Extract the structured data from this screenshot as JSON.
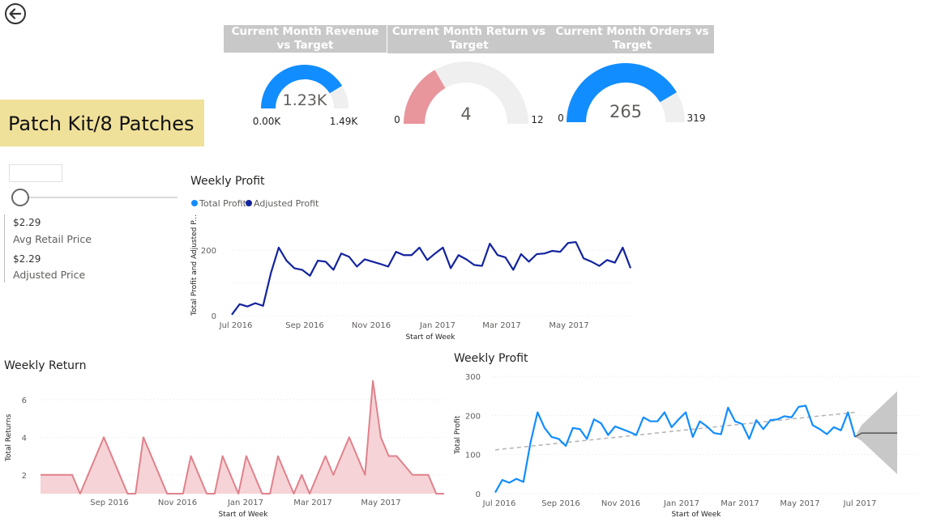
{
  "nav": {
    "back_icon": "back-arrow-icon"
  },
  "kpis": [
    {
      "title": "Current Month Revenue vs Target",
      "value": "1.23K",
      "min": "0.00K",
      "max": "1.49K",
      "fill_fraction": 0.826,
      "color": "#118dff"
    },
    {
      "title": "Current Month Return vs Target",
      "value": "4",
      "min": "0",
      "max": "12",
      "fill_fraction": 0.333,
      "color": "#e8959c"
    },
    {
      "title": "Current Month Orders vs Target",
      "value": "265",
      "min": "0",
      "max": "319",
      "fill_fraction": 0.831,
      "color": "#118dff"
    }
  ],
  "product": {
    "name": "Patch Kit/8 Patches"
  },
  "prices": {
    "avg_retail_value": "$2.29",
    "avg_retail_label": "Avg Retail Price",
    "adjusted_value": "$2.29",
    "adjusted_label": "Adjusted Price"
  },
  "colors": {
    "total_profit": "#118dff",
    "adjusted_profit": "#12239e",
    "returns_line": "#e0818c",
    "returns_fill": "#f6d3d6",
    "trend": "#b3b3b3",
    "forecast": "#c8c8c8"
  },
  "chart_data": [
    {
      "id": "weekly_profit_top",
      "type": "line",
      "title": "Weekly Profit",
      "xlabel": "Start of Week",
      "ylabel": "Total Profit and Adjusted P...",
      "legend": [
        "Total Profit",
        "Adjusted Profit"
      ],
      "legend_position": "top-left",
      "x_ticks": [
        "Jul 2016",
        "Sep 2016",
        "Nov 2016",
        "Jan 2017",
        "Mar 2017",
        "May 2017"
      ],
      "y_ticks": [
        "0",
        "200"
      ],
      "ylim": [
        0,
        240
      ],
      "series": [
        {
          "name": "Adjusted Profit",
          "values": [
            3,
            35,
            28,
            38,
            30,
            130,
            208,
            168,
            145,
            140,
            122,
            168,
            165,
            140,
            190,
            180,
            150,
            172,
            165,
            158,
            150,
            195,
            185,
            185,
            208,
            170,
            190,
            208,
            145,
            185,
            172,
            155,
            152,
            220,
            185,
            178,
            140,
            188,
            165,
            188,
            190,
            198,
            195,
            222,
            225,
            175,
            165,
            152,
            170,
            162,
            208,
            145
          ]
        }
      ]
    },
    {
      "id": "weekly_return",
      "type": "area",
      "title": "Weekly Return",
      "xlabel": "Start of Week",
      "ylabel": "Total Returns",
      "x_ticks": [
        "Sep 2016",
        "Nov 2016",
        "Jan 2017",
        "Mar 2017",
        "May 2017"
      ],
      "y_ticks": [
        "2",
        "4",
        "6"
      ],
      "ylim": [
        1,
        7.2
      ],
      "series": [
        {
          "name": "",
          "values": [
            2,
            2,
            2,
            2,
            2,
            1,
            2,
            3,
            4,
            3,
            2,
            1,
            1,
            4,
            3,
            2,
            1,
            1,
            1,
            3,
            2,
            1,
            1,
            3,
            2,
            1,
            3,
            2,
            1,
            1,
            3,
            2,
            1,
            2,
            1,
            2,
            3,
            2,
            3,
            4,
            3,
            2,
            7,
            4,
            3,
            3,
            2.5,
            2,
            2,
            2,
            1,
            1
          ]
        }
      ]
    },
    {
      "id": "weekly_profit_forecast",
      "type": "line",
      "title": "Weekly Profit",
      "xlabel": "Start of Week",
      "ylabel": "Total Profit",
      "x_ticks": [
        "Jul 2016",
        "Sep 2016",
        "Nov 2016",
        "Jan 2017",
        "Mar 2017",
        "May 2017",
        "Jul 2017"
      ],
      "y_ticks": [
        "0",
        "100",
        "200",
        "300"
      ],
      "ylim": [
        0,
        300
      ],
      "series": [
        {
          "name": "Total Profit",
          "values": [
            3,
            35,
            28,
            38,
            30,
            130,
            208,
            168,
            145,
            140,
            122,
            168,
            165,
            140,
            190,
            180,
            150,
            172,
            165,
            158,
            150,
            195,
            185,
            185,
            208,
            170,
            190,
            208,
            145,
            185,
            172,
            155,
            152,
            220,
            185,
            178,
            140,
            188,
            165,
            188,
            190,
            198,
            195,
            222,
            225,
            175,
            165,
            152,
            170,
            162,
            208,
            145
          ]
        }
      ],
      "trend": {
        "start": 112,
        "end": 208
      },
      "forecast": {
        "value": 155,
        "upper_end": 262,
        "lower_end": 50
      }
    }
  ]
}
